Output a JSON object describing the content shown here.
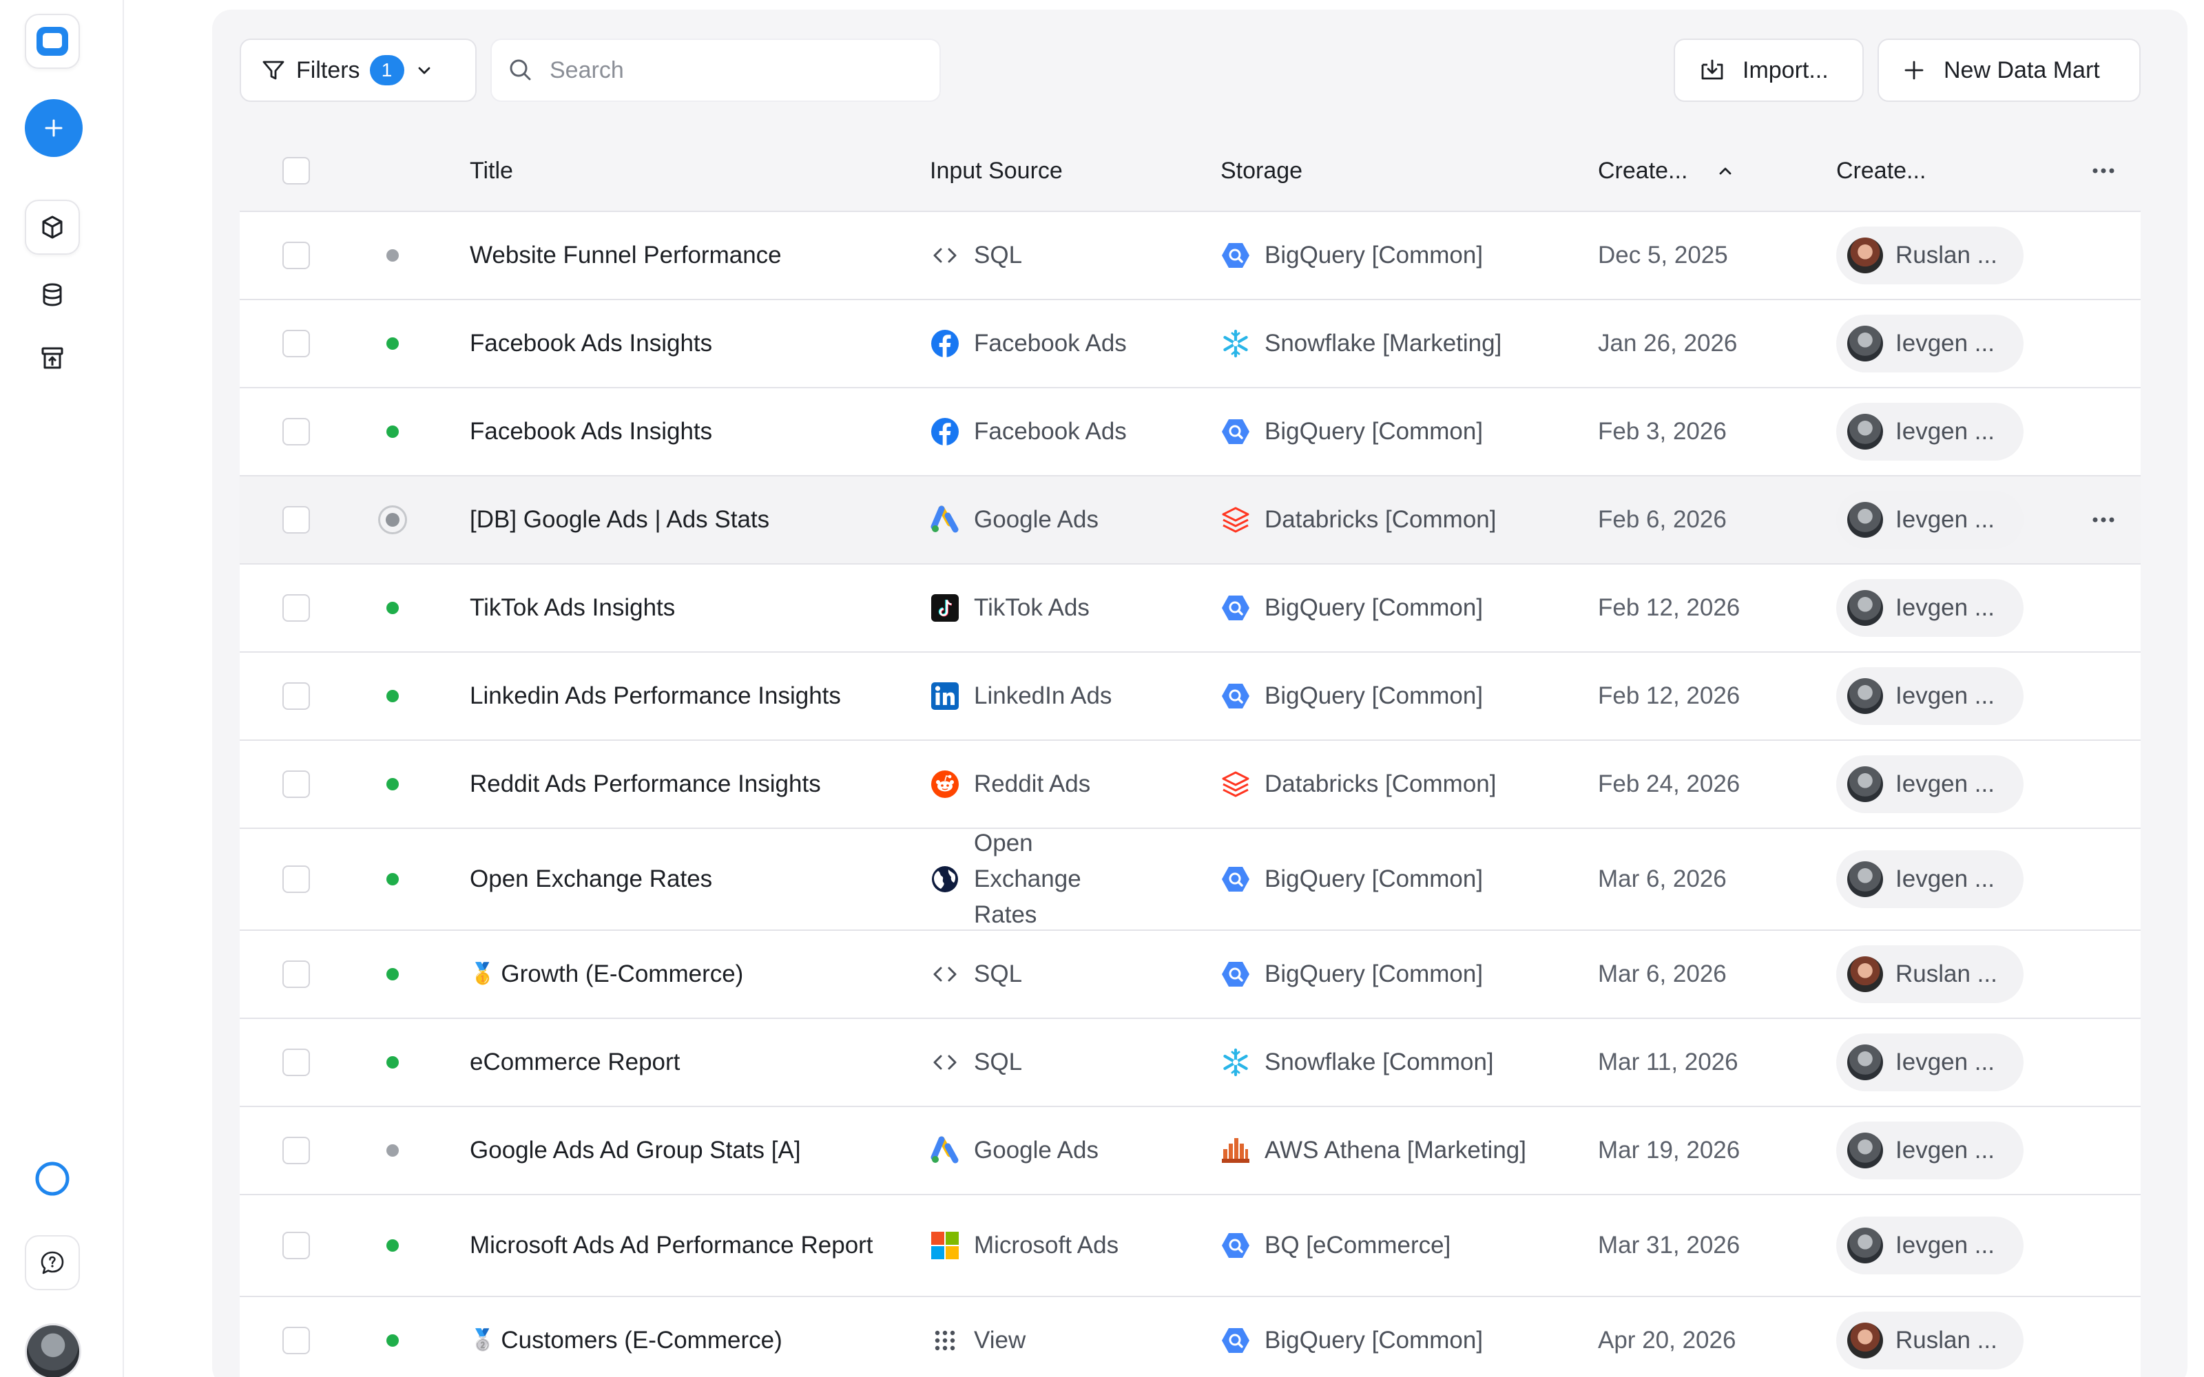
{
  "toolbar": {
    "filters_label": "Filters",
    "filters_count": "1",
    "search_placeholder": "Search",
    "import_label": "Import...",
    "new_label": "New Data Mart"
  },
  "table": {
    "columns": {
      "title": "Title",
      "input_source": "Input Source",
      "storage": "Storage",
      "created_at": "Create...",
      "created_by": "Create..."
    },
    "rows": [
      {
        "status": "gray",
        "title": "Website Funnel Performance",
        "source": "SQL",
        "source_icon": "code-icon",
        "storage": "BigQuery [Common]",
        "storage_icon": "bigquery-icon",
        "date": "Dec 5, 2025",
        "owner": "Ruslan ..."
      },
      {
        "status": "green",
        "title": "Facebook Ads Insights",
        "source": "Facebook Ads",
        "source_icon": "facebook-icon",
        "storage": "Snowflake [Marketing]",
        "storage_icon": "snowflake-icon",
        "date": "Jan 26, 2026",
        "owner": "Ievgen ..."
      },
      {
        "status": "green",
        "title": "Facebook Ads Insights",
        "source": "Facebook Ads",
        "source_icon": "facebook-icon",
        "storage": "BigQuery [Common]",
        "storage_icon": "bigquery-icon",
        "date": "Feb 3, 2026",
        "owner": "Ievgen ..."
      },
      {
        "status": "radio",
        "title": "[DB] Google Ads | Ads Stats",
        "source": "Google Ads",
        "source_icon": "google-ads-icon",
        "storage": "Databricks [Common]",
        "storage_icon": "databricks-icon",
        "date": "Feb 6, 2026",
        "owner": "Ievgen ..."
      },
      {
        "status": "green",
        "title": "TikTok Ads Insights",
        "source": "TikTok Ads",
        "source_icon": "tiktok-icon",
        "storage": "BigQuery [Common]",
        "storage_icon": "bigquery-icon",
        "date": "Feb 12, 2026",
        "owner": "Ievgen ..."
      },
      {
        "status": "green",
        "title": "Linkedin Ads Performance Insights",
        "source": "LinkedIn Ads",
        "source_icon": "linkedin-icon",
        "storage": "BigQuery [Common]",
        "storage_icon": "bigquery-icon",
        "date": "Feb 12, 2026",
        "owner": "Ievgen ..."
      },
      {
        "status": "green",
        "title": "Reddit Ads Performance Insights",
        "source": "Reddit Ads",
        "source_icon": "reddit-icon",
        "storage": "Databricks [Common]",
        "storage_icon": "databricks-icon",
        "date": "Feb 24, 2026",
        "owner": "Ievgen ..."
      },
      {
        "status": "green",
        "title": "Open Exchange Rates",
        "source": "Open Exchange Rates",
        "source_icon": "globe-icon",
        "storage": "BigQuery [Common]",
        "storage_icon": "bigquery-icon",
        "date": "Mar 6, 2026",
        "owner": "Ievgen ..."
      },
      {
        "status": "green",
        "title_emoji": "🥇",
        "title": "Growth (E-Commerce)",
        "source": "SQL",
        "source_icon": "code-icon",
        "storage": "BigQuery [Common]",
        "storage_icon": "bigquery-icon",
        "date": "Mar 6, 2026",
        "owner": "Ruslan ..."
      },
      {
        "status": "green",
        "title": "eCommerce Report",
        "source": "SQL",
        "source_icon": "code-icon",
        "storage": "Snowflake [Common]",
        "storage_icon": "snowflake-icon",
        "date": "Mar 11, 2026",
        "owner": "Ievgen ..."
      },
      {
        "status": "gray",
        "title": "Google Ads Ad Group Stats [A]",
        "source": "Google Ads",
        "source_icon": "google-ads-icon",
        "storage": "AWS Athena [Marketing]",
        "storage_icon": "athena-icon",
        "date": "Mar 19, 2026",
        "owner": "Ievgen ..."
      },
      {
        "status": "green",
        "title": "Microsoft Ads Ad Performance Report",
        "source": "Microsoft Ads",
        "source_icon": "microsoft-icon",
        "storage": "BQ [eCommerce]",
        "storage_icon": "bigquery-icon",
        "date": "Mar 31, 2026",
        "owner": "Ievgen ..."
      },
      {
        "status": "green",
        "title_emoji": "🥈",
        "title": "Customers (E-Commerce)",
        "source": "View",
        "source_icon": "grid-dots-icon",
        "storage": "BigQuery [Common]",
        "storage_icon": "bigquery-icon",
        "date": "Apr 20, 2026",
        "owner": "Ruslan ..."
      }
    ]
  },
  "colors": {
    "accent": "#1f86ee",
    "status_green": "#1fae4a",
    "status_gray": "#9ea2a8"
  }
}
